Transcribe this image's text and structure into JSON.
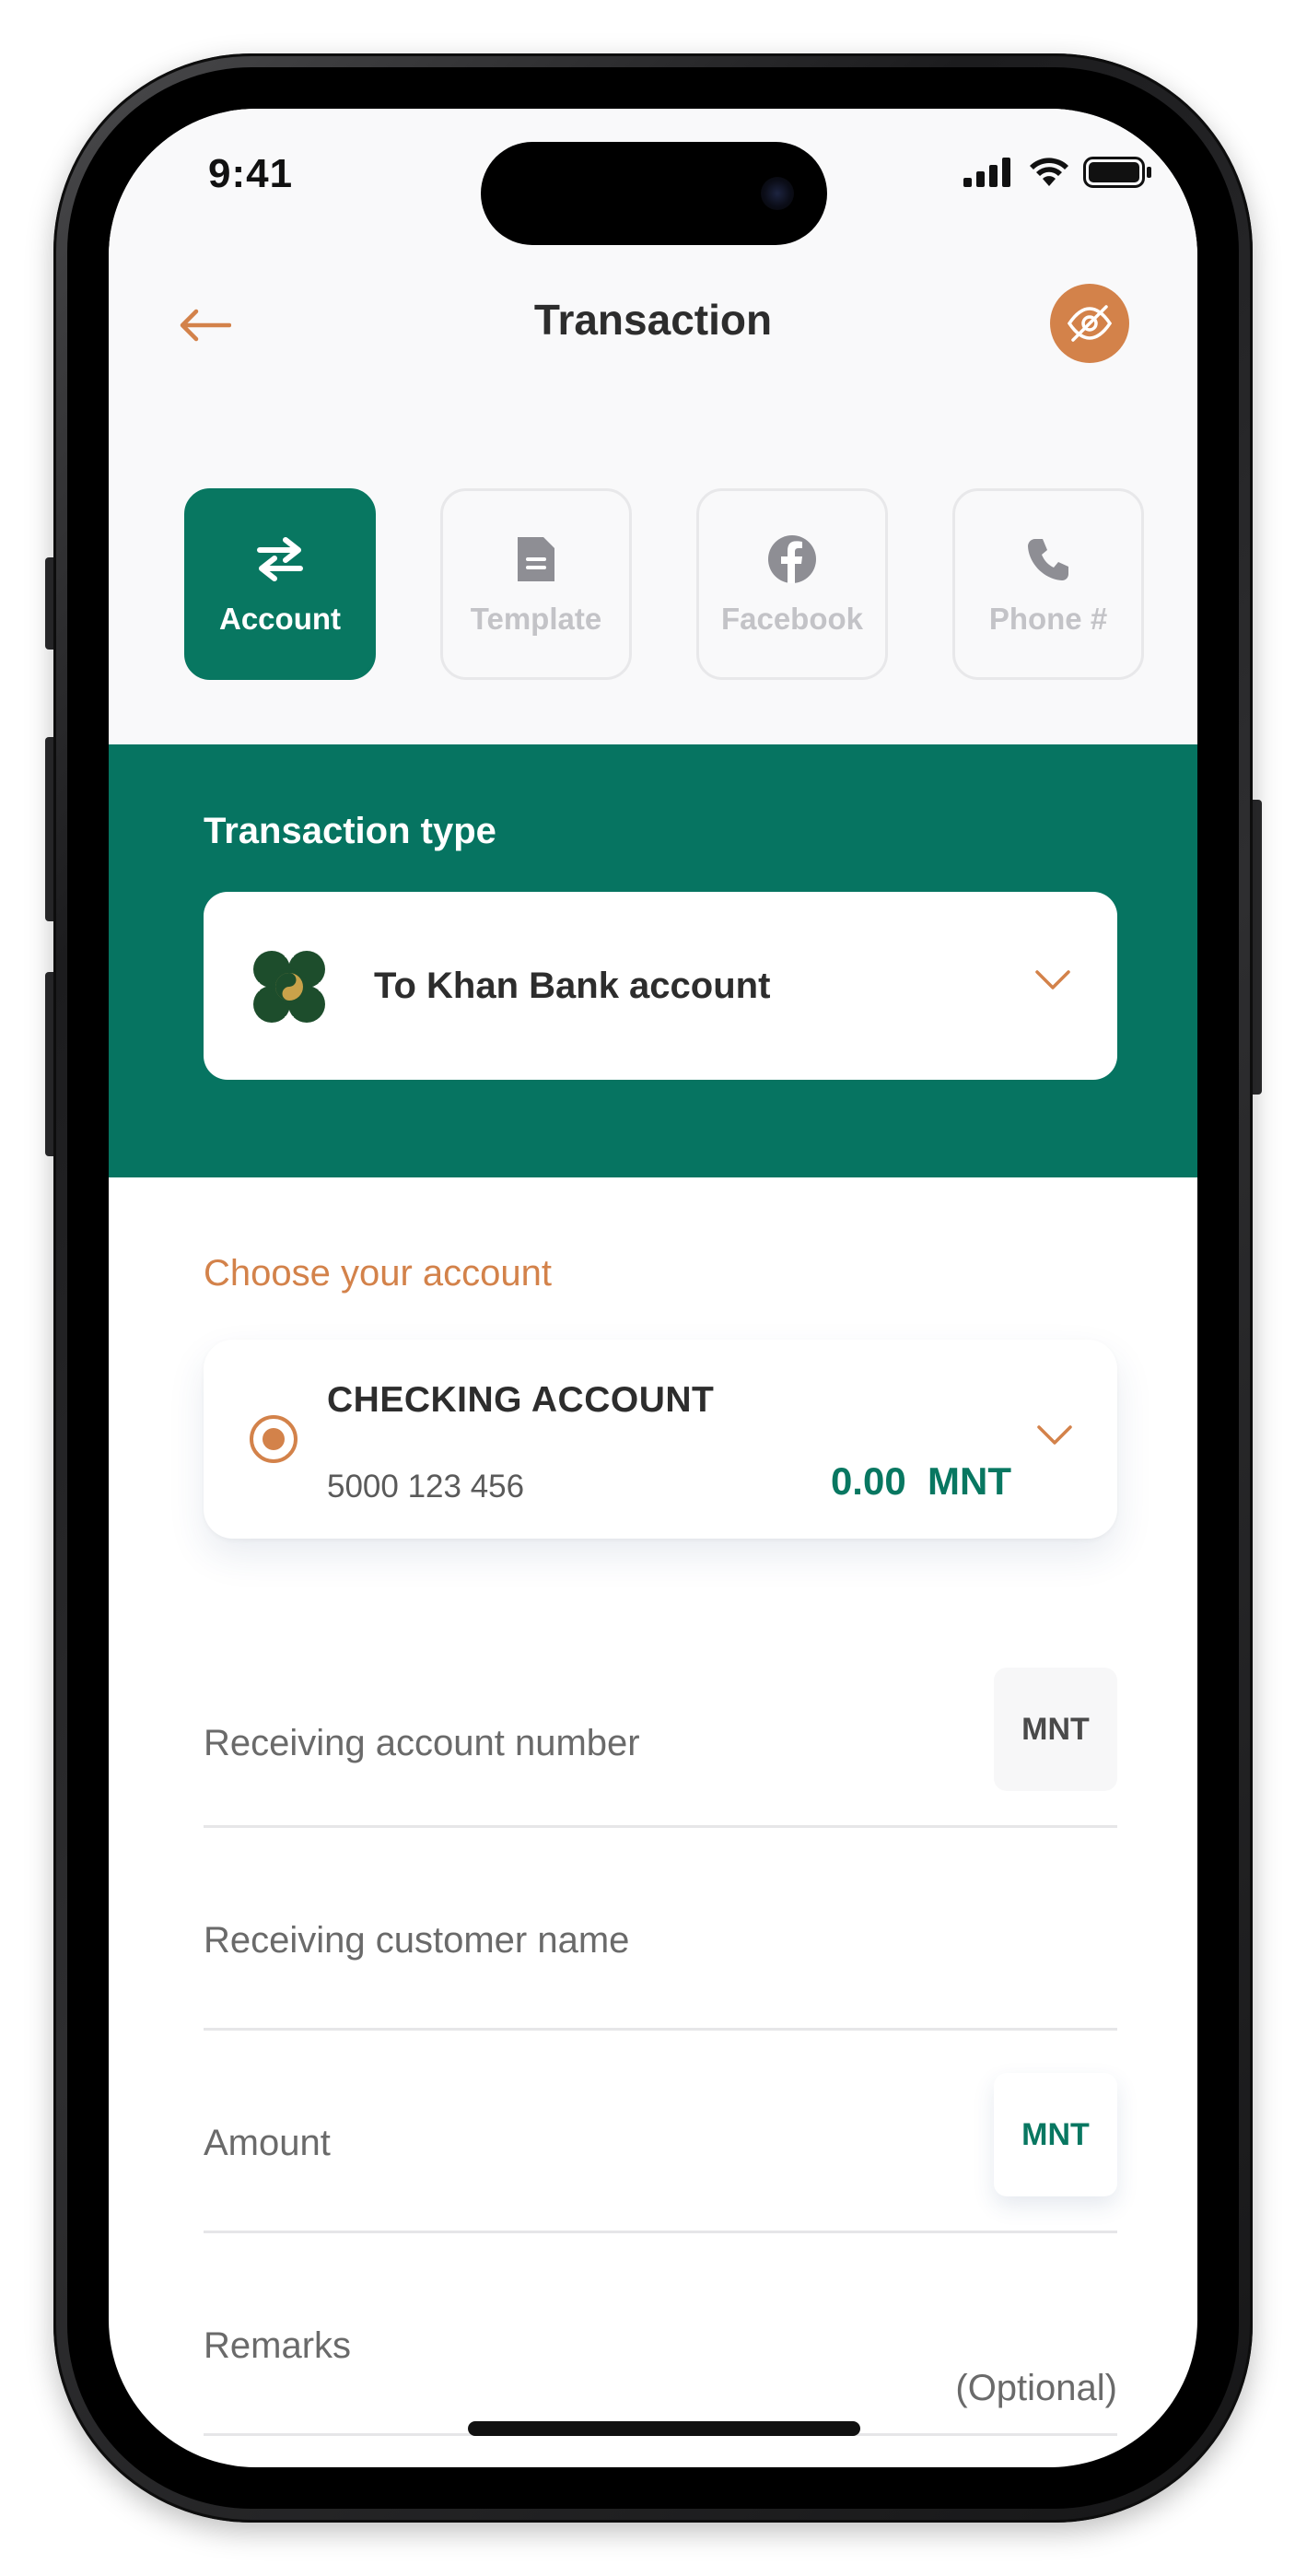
{
  "status_bar": {
    "time": "9:41"
  },
  "header": {
    "title": "Transaction"
  },
  "tabs": [
    {
      "label": "Account",
      "icon": "transfer-arrows-icon",
      "active": true
    },
    {
      "label": "Template",
      "icon": "document-icon",
      "active": false
    },
    {
      "label": "Facebook",
      "icon": "facebook-icon",
      "active": false
    },
    {
      "label": "Phone #",
      "icon": "phone-icon",
      "active": false
    }
  ],
  "transaction_type": {
    "title": "Transaction type",
    "selected": "To Khan Bank account"
  },
  "account": {
    "section_label": "Choose your account",
    "name": "CHECKING ACCOUNT",
    "number": "5000 123 456",
    "balance": "0.00  MNT"
  },
  "form": {
    "receiving_account_label": "Receiving account number",
    "receiving_account_currency": "MNT",
    "receiving_name_label": "Receiving customer name",
    "amount_label": "Amount",
    "amount_currency": "MNT",
    "remarks_label": "Remarks",
    "remarks_optional": "(Optional)"
  },
  "colors": {
    "brand_green": "#087761",
    "accent_orange": "#d3824a",
    "text_dark": "#2d2d2d"
  }
}
